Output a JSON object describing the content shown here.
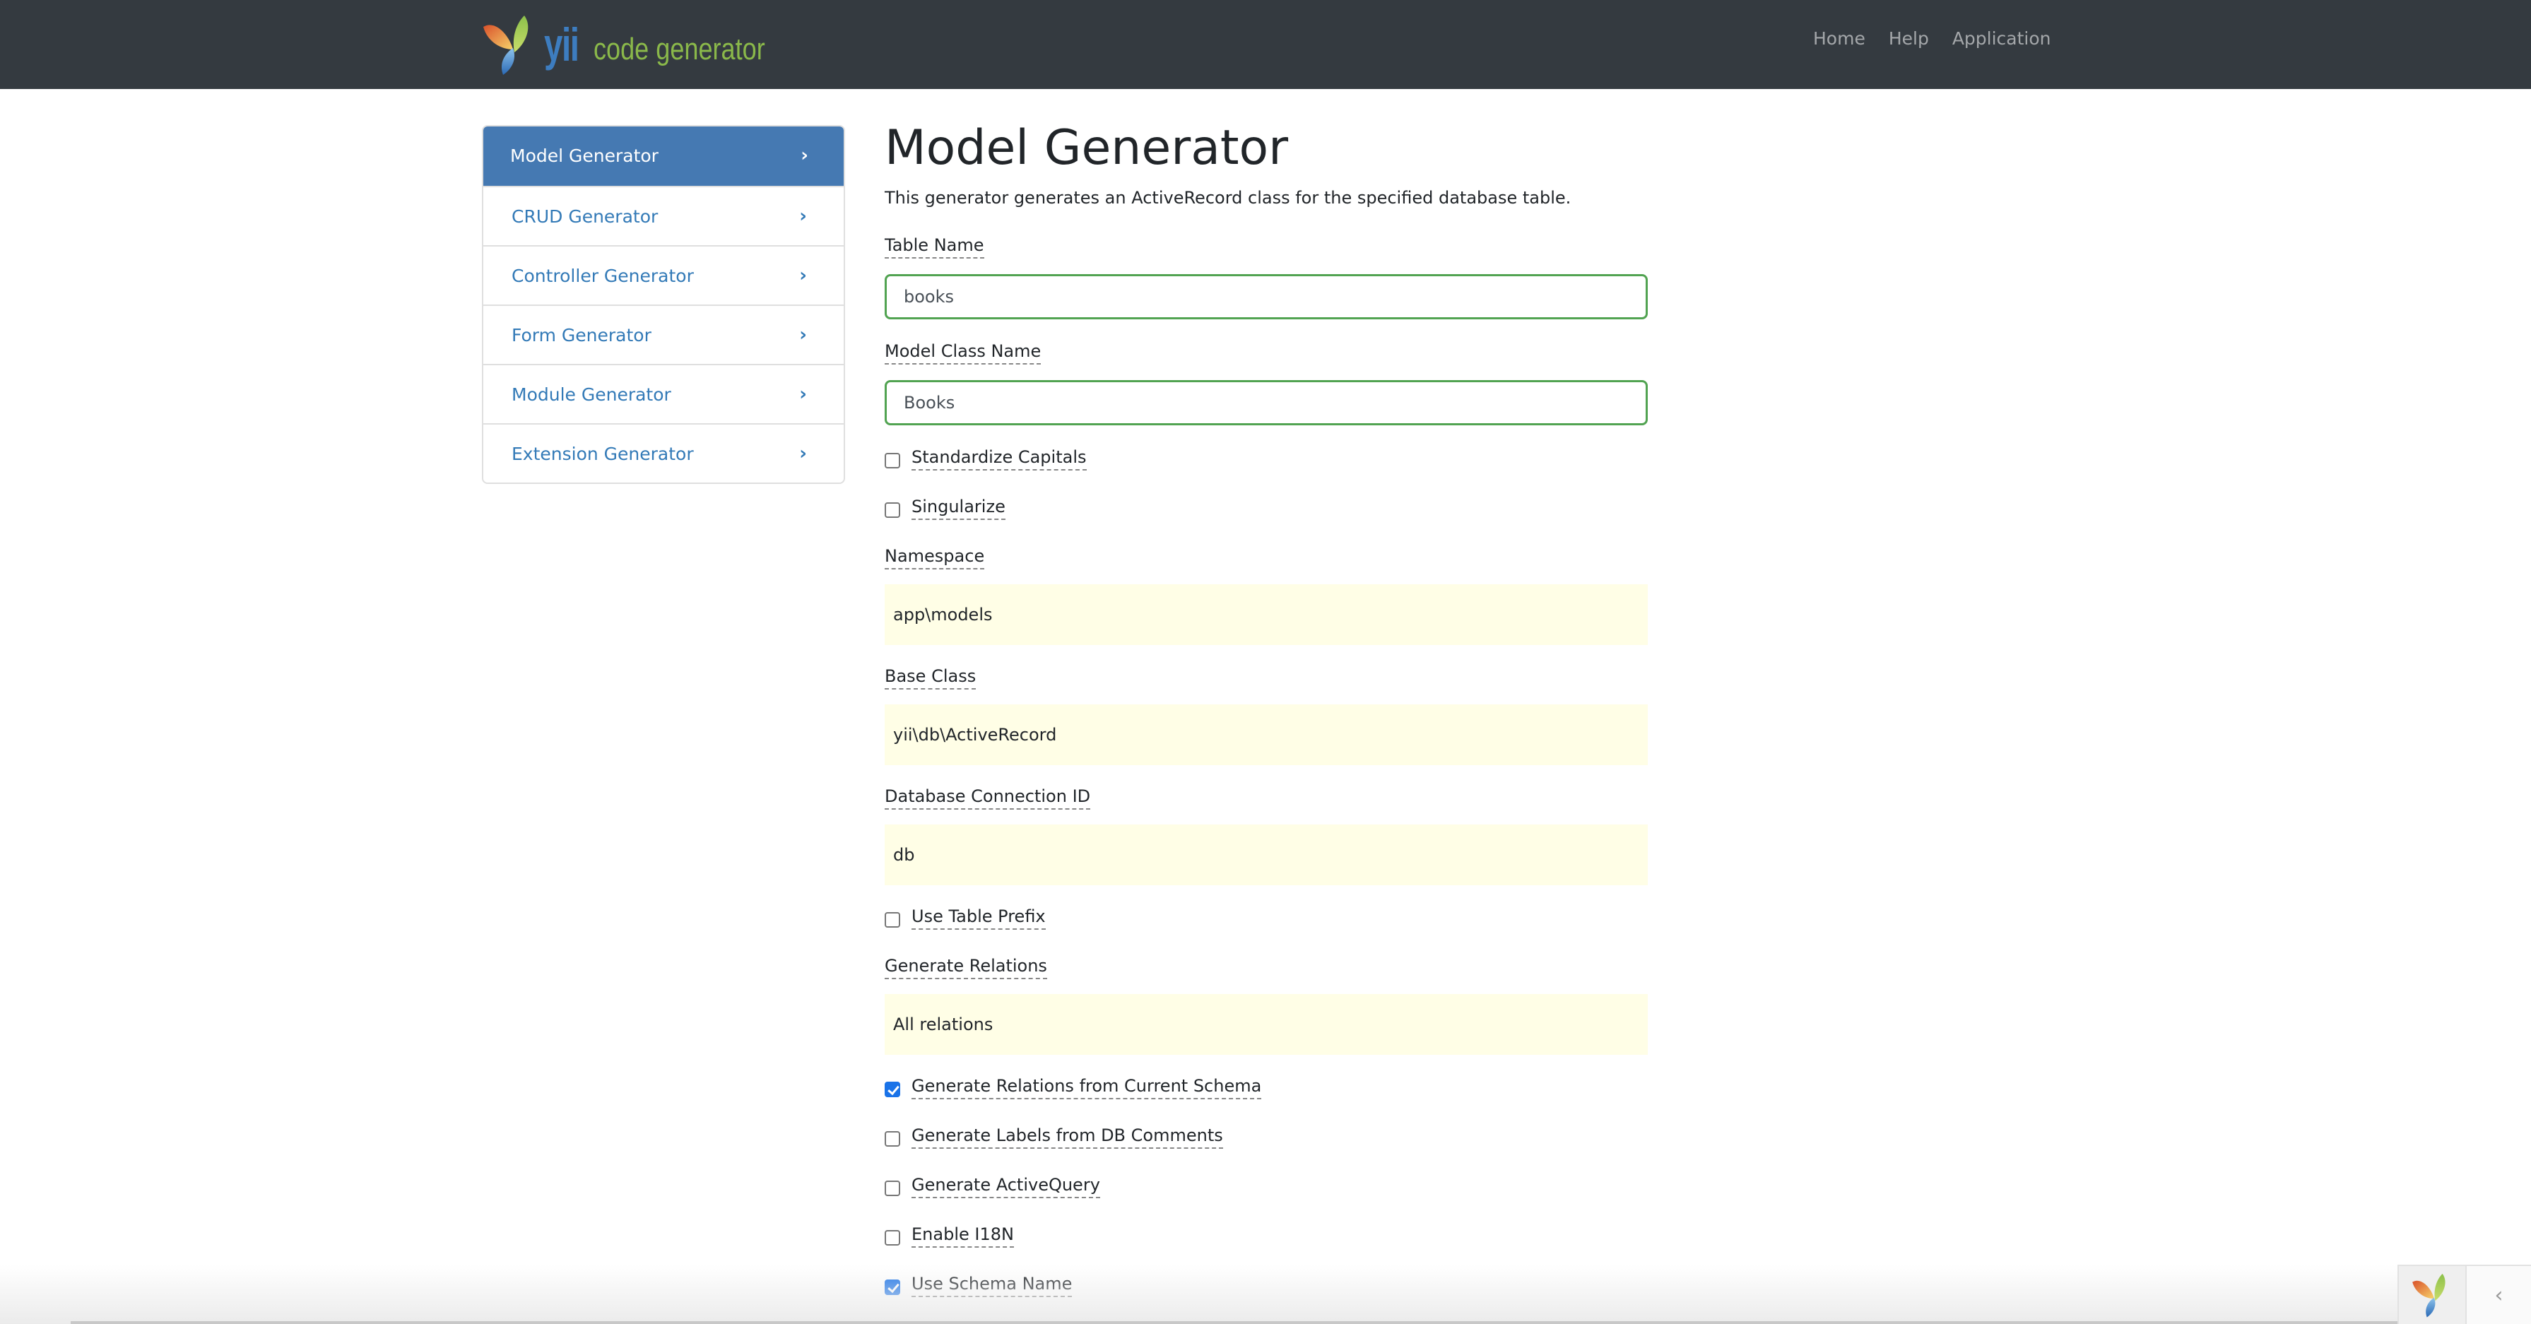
{
  "navbar": {
    "brand": {
      "logo_icon": "yii-logo-icon",
      "name": "yii",
      "subtitle": "code generator"
    },
    "links": [
      "Home",
      "Help",
      "Application"
    ]
  },
  "sidebar": {
    "items": [
      {
        "label": "Model Generator",
        "active": true,
        "icon": "chevron-right-icon"
      },
      {
        "label": "CRUD Generator",
        "active": false,
        "icon": "chevron-right-icon"
      },
      {
        "label": "Controller Generator",
        "active": false,
        "icon": "chevron-right-icon"
      },
      {
        "label": "Form Generator",
        "active": false,
        "icon": "chevron-right-icon"
      },
      {
        "label": "Module Generator",
        "active": false,
        "icon": "chevron-right-icon"
      },
      {
        "label": "Extension Generator",
        "active": false,
        "icon": "chevron-right-icon"
      }
    ],
    "chevron_glyph": "›"
  },
  "main": {
    "title": "Model Generator",
    "description": "This generator generates an ActiveRecord class for the specified database table.",
    "fields": {
      "table_name": {
        "label": "Table Name",
        "value": "books"
      },
      "model_class": {
        "label": "Model Class Name",
        "value": "Books"
      },
      "namespace": {
        "label": "Namespace",
        "value": "app\\models"
      },
      "base_class": {
        "label": "Base Class",
        "value": "yii\\db\\ActiveRecord"
      },
      "db_conn": {
        "label": "Database Connection ID",
        "value": "db"
      },
      "gen_relations": {
        "label": "Generate Relations",
        "value": "All relations"
      }
    },
    "checkboxes": {
      "standardize_capitals": {
        "label": "Standardize Capitals",
        "checked": false
      },
      "singularize": {
        "label": "Singularize",
        "checked": false
      },
      "use_table_prefix": {
        "label": "Use Table Prefix",
        "checked": false
      },
      "relations_current_schema": {
        "label": "Generate Relations from Current Schema",
        "checked": true
      },
      "labels_from_db_comments": {
        "label": "Generate Labels from DB Comments",
        "checked": false
      },
      "generate_active_query": {
        "label": "Generate ActiveQuery",
        "checked": false
      },
      "enable_i18n": {
        "label": "Enable I18N",
        "checked": false
      },
      "use_schema_name": {
        "label": "Use Schema Name",
        "checked": true
      }
    }
  },
  "debug_toolbar": {
    "logo_icon": "yii-logo-icon",
    "toggle_glyph": "‹"
  },
  "colors": {
    "navbar_bg": "#343a40",
    "sidebar_active_bg": "#4579b2",
    "link": "#337ab7",
    "valid_border": "#51a351",
    "sticky_bg": "#fffee6",
    "checkbox_checked": "#1a73e8"
  }
}
